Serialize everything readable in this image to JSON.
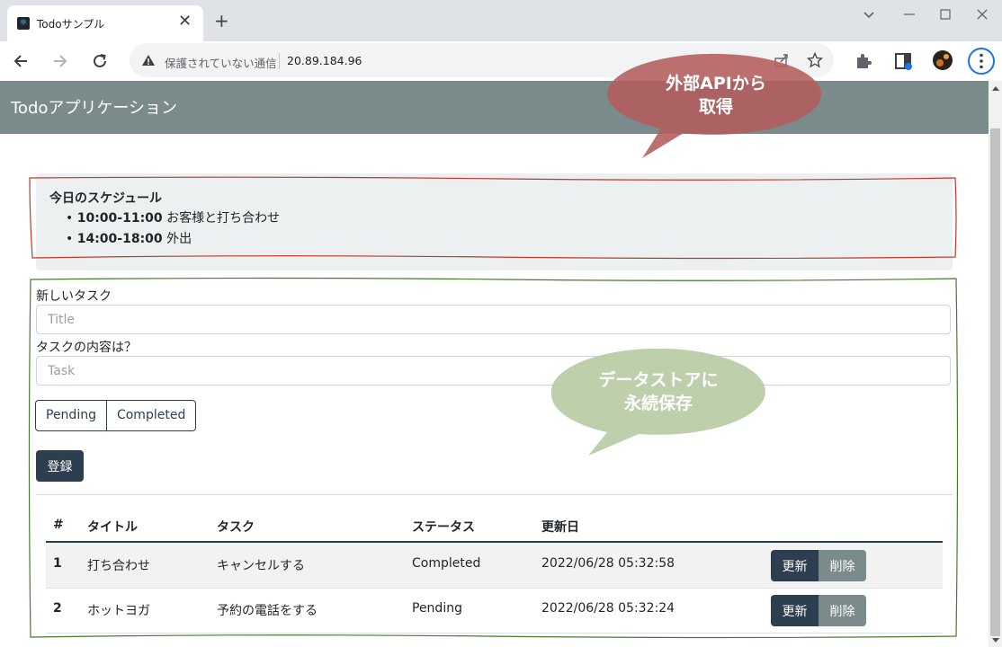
{
  "browser": {
    "tab_title": "Todoサンプル",
    "tab_close": "✕",
    "new_tab": "+",
    "security_label": "保護されていない通信",
    "url": "20.89.184.96"
  },
  "app": {
    "brand": "Todoアプリケーション"
  },
  "schedule": {
    "title": "今日のスケジュール",
    "items": [
      {
        "time": "10:00-11:00",
        "text": "お客様と打ち合わせ"
      },
      {
        "time": "14:00-18:00",
        "text": "外出"
      }
    ]
  },
  "form": {
    "title_label": "新しいタスク",
    "title_placeholder": "Title",
    "task_label": "タスクの内容は？",
    "task_placeholder": "Task",
    "status_options": [
      "Pending",
      "Completed"
    ],
    "submit_label": "登録"
  },
  "table": {
    "headers": [
      "#",
      "タイトル",
      "タスク",
      "ステータス",
      "更新日"
    ],
    "rows": [
      {
        "id": "1",
        "title": "打ち合わせ",
        "task": "キャンセルする",
        "status": "Completed",
        "updated": "2022/06/28 05:32:58"
      },
      {
        "id": "2",
        "title": "ホットヨガ",
        "task": "予約の電話をする",
        "status": "Pending",
        "updated": "2022/06/28 05:32:24"
      }
    ],
    "update_label": "更新",
    "delete_label": "削除"
  },
  "annotations": {
    "api_callout_line1": "外部APIから",
    "api_callout_line2": "取得",
    "store_callout_line1": "データストアに",
    "store_callout_line2": "永続保存"
  },
  "colors": {
    "primary": "#2c3e50",
    "navbar": "#7b8a8b",
    "api_outline": "#c0392b",
    "store_outline": "#4a7a2c",
    "api_callout_fill": "#b35c5c",
    "store_callout_fill": "#b7cba4"
  }
}
